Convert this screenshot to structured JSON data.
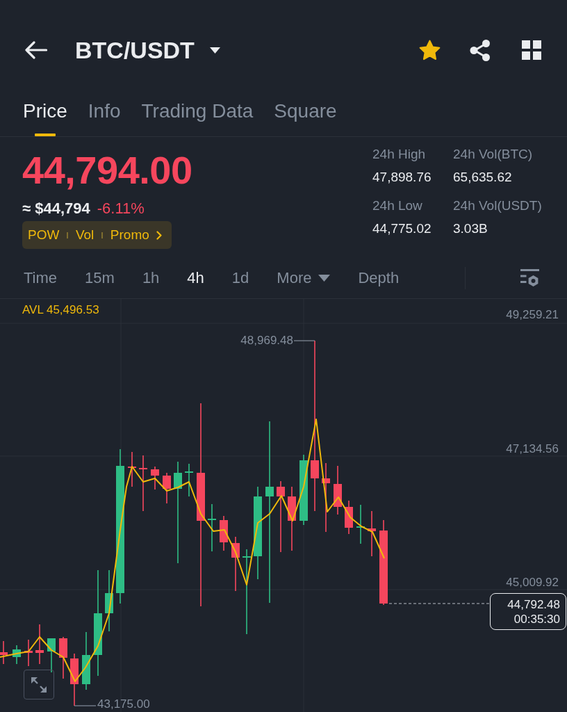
{
  "header": {
    "title": "BTC/USDT",
    "favorite": true
  },
  "tabs": [
    {
      "label": "Price",
      "selected": true
    },
    {
      "label": "Info",
      "selected": false
    },
    {
      "label": "Trading Data",
      "selected": false
    },
    {
      "label": "Square",
      "selected": false
    }
  ],
  "ticker": {
    "price": "44,794.00",
    "negative": true,
    "fiat_price": "≈ $44,794",
    "change": "-6.11%",
    "tags": [
      "POW",
      "Vol",
      "Promo"
    ]
  },
  "stats": [
    {
      "label": "24h High",
      "value": "47,898.76"
    },
    {
      "label": "24h Vol(BTC)",
      "value": "65,635.62"
    },
    {
      "label": "24h Low",
      "value": "44,775.02"
    },
    {
      "label": "24h Vol(USDT)",
      "value": "3.03B"
    }
  ],
  "intervals": [
    {
      "label": "Time",
      "kind": "option",
      "selected": false
    },
    {
      "label": "15m",
      "kind": "option",
      "selected": false
    },
    {
      "label": "1h",
      "kind": "option",
      "selected": false
    },
    {
      "label": "4h",
      "kind": "option",
      "selected": true
    },
    {
      "label": "1d",
      "kind": "option",
      "selected": false
    },
    {
      "label": "More",
      "kind": "menu",
      "selected": false
    },
    {
      "label": "Depth",
      "kind": "option",
      "selected": false
    }
  ],
  "chart": {
    "average": "AVL 45,496.53",
    "price_scale": [
      "49,259.21",
      "47,134.56",
      "45,009.92"
    ],
    "high": "48,969.48",
    "low": "43,175.00",
    "last_price": "44,792.48",
    "countdown": "00:35:30"
  }
}
